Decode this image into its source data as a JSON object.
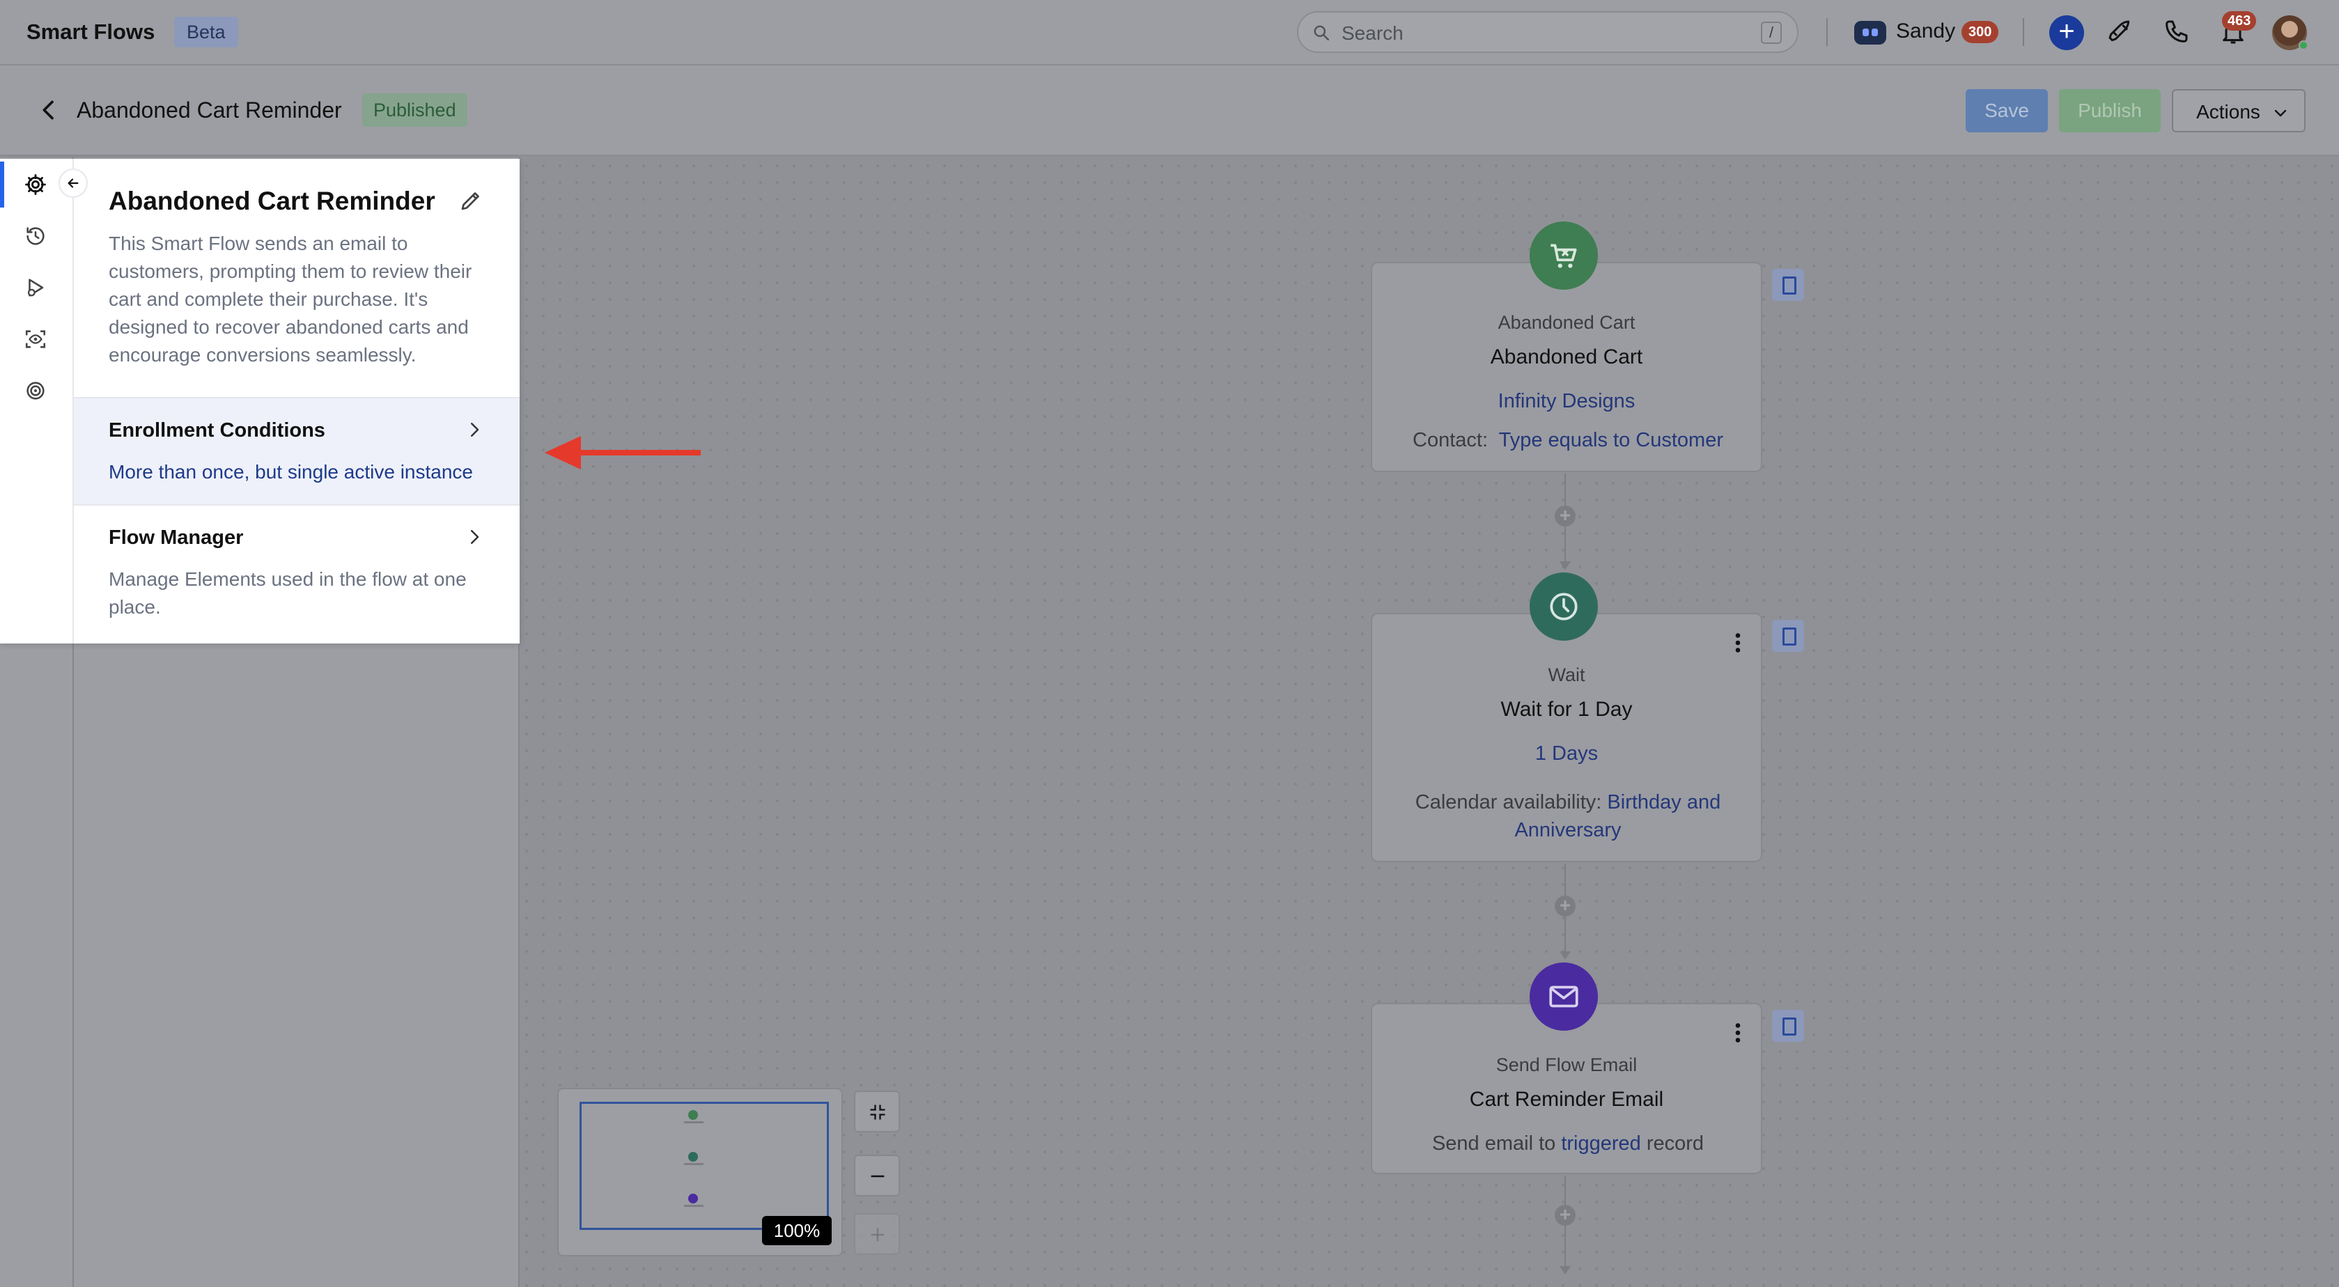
{
  "app": {
    "name": "Smart Flows",
    "badge": "Beta"
  },
  "search": {
    "placeholder": "Search",
    "shortcut": "/"
  },
  "user": {
    "name": "Sandy",
    "credits": "300",
    "notifications": "463"
  },
  "flow": {
    "title": "Abandoned Cart Reminder",
    "status": "Published"
  },
  "header_actions": {
    "save": "Save",
    "publish": "Publish",
    "actions": "Actions"
  },
  "sidebar": {
    "rail": [
      "settings-icon",
      "history-icon",
      "test-run-icon",
      "preview-icon",
      "goal-icon"
    ],
    "title": "Abandoned Cart Reminder",
    "description": "This Smart Flow sends an email to customers, prompting them to review their cart and complete their purchase. It's designed to recover abandoned carts and encourage conversions seamlessly.",
    "sections": [
      {
        "title": "Enrollment Conditions",
        "subtitle": "More than once, but single active instance"
      },
      {
        "title": "Flow Manager",
        "subtitle": "Manage Elements used in the flow at one place."
      }
    ]
  },
  "nodes": [
    {
      "type": "Abandoned Cart",
      "name": "Abandoned Cart",
      "line": "Infinity Designs",
      "detail_label": "Contact:",
      "detail_value": "Type equals to Customer"
    },
    {
      "type": "Wait",
      "name": "Wait for 1 Day",
      "line": "1 Days",
      "detail_label": "Calendar availability:",
      "detail_value": "Birthday and Anniversary"
    },
    {
      "type": "Send Flow Email",
      "name": "Cart Reminder Email",
      "detail_pre": "Send email to",
      "detail_link": "triggered",
      "detail_post": "record"
    }
  ],
  "zoom": "100%",
  "colors": {
    "accent": "#2563eb",
    "trigger": "#3f7d52",
    "wait": "#2f6b5c",
    "email": "#4a2ba0",
    "annotation": "#e5392b"
  }
}
